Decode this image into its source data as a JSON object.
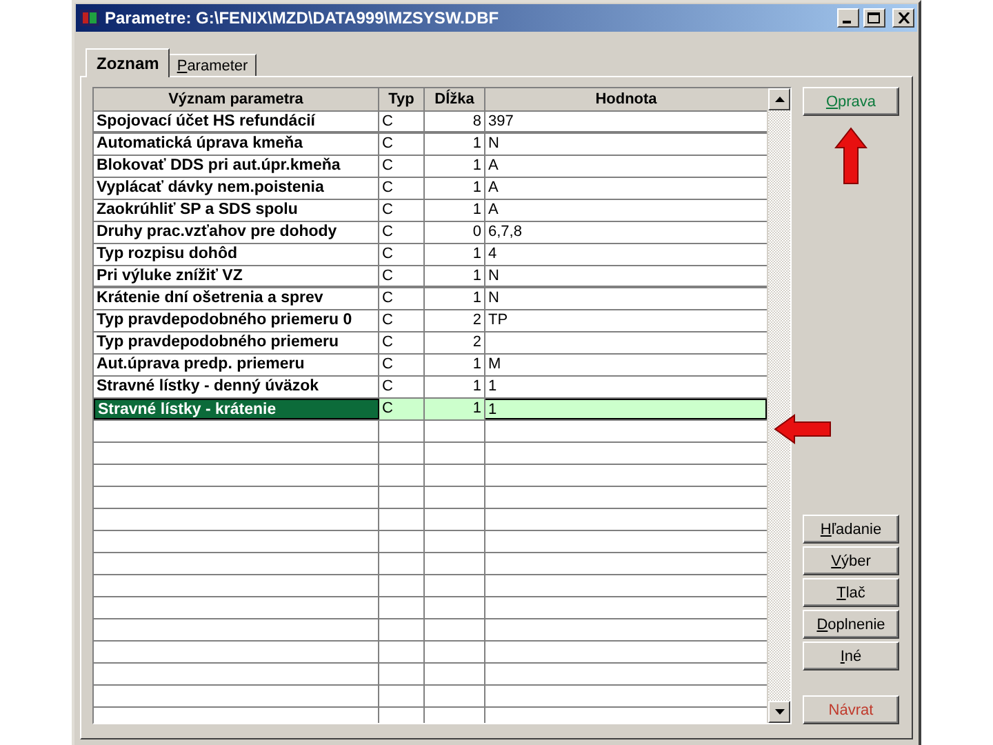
{
  "window": {
    "title": "Parametre: G:\\FENIX\\MZD\\DATA999\\MZSYSW.DBF"
  },
  "tabs": [
    {
      "label": "Zoznam",
      "selected": true
    },
    {
      "label": "Parameter",
      "selected": false,
      "mnemonic": true
    }
  ],
  "table": {
    "columns": [
      "Význam parametra",
      "Typ",
      "Dĺžka",
      "Hodnota"
    ],
    "rows": [
      {
        "name": "Spojovací účet HS refundácií",
        "type": "C",
        "length": "8",
        "value": "397",
        "selected": false,
        "separator_below": true
      },
      {
        "name": "Automatická úprava kmeňa",
        "type": "C",
        "length": "1",
        "value": "N",
        "selected": false,
        "separator_below": false
      },
      {
        "name": "Blokovať DDS pri aut.úpr.kmeňa",
        "type": "C",
        "length": "1",
        "value": "A",
        "selected": false,
        "separator_below": false
      },
      {
        "name": "Vyplácať dávky nem.poistenia",
        "type": "C",
        "length": "1",
        "value": "A",
        "selected": false,
        "separator_below": false
      },
      {
        "name": "Zaokrúhliť SP a SDS spolu",
        "type": "C",
        "length": "1",
        "value": "A",
        "selected": false,
        "separator_below": false
      },
      {
        "name": "Druhy prac.vzťahov pre dohody",
        "type": "C",
        "length": "0",
        "value": "6,7,8",
        "selected": false,
        "separator_below": false
      },
      {
        "name": "Typ rozpisu dohôd",
        "type": "C",
        "length": "1",
        "value": "4",
        "selected": false,
        "separator_below": false
      },
      {
        "name": "Pri výluke znížiť VZ",
        "type": "C",
        "length": "1",
        "value": "N",
        "selected": false,
        "separator_below": true
      },
      {
        "name": "Krátenie dní ošetrenia a sprev",
        "type": "C",
        "length": "1",
        "value": "N",
        "selected": false,
        "separator_below": false
      },
      {
        "name": "Typ pravdepodobného priemeru 0",
        "type": "C",
        "length": "2",
        "value": "TP",
        "selected": false,
        "separator_below": false
      },
      {
        "name": "Typ pravdepodobného priemeru",
        "type": "C",
        "length": "2",
        "selected": false,
        "separator_below": false
      },
      {
        "name": "Aut.úprava predp. priemeru",
        "type": "C",
        "length": "1",
        "value": "M",
        "selected": false,
        "separator_below": false
      },
      {
        "name": "Stravné lístky - denný úväzok",
        "type": "C",
        "length": "1",
        "value": "1",
        "selected": false,
        "separator_below": false
      },
      {
        "name": "Stravné lístky - krátenie",
        "type": "C",
        "length": "1",
        "value": "1",
        "selected": true,
        "separator_below": false
      }
    ]
  },
  "top_button": {
    "label": "Oprava",
    "mnemonic": true
  },
  "buttons": [
    {
      "label": "Hľadanie",
      "mnemonic": true
    },
    {
      "label": "Výber",
      "mnemonic": true
    },
    {
      "label": "Tlač",
      "mnemonic": true
    },
    {
      "label": "Doplnenie",
      "mnemonic": true
    },
    {
      "label": "Iné",
      "mnemonic": true
    }
  ],
  "return_button": {
    "label": "Návrat"
  }
}
